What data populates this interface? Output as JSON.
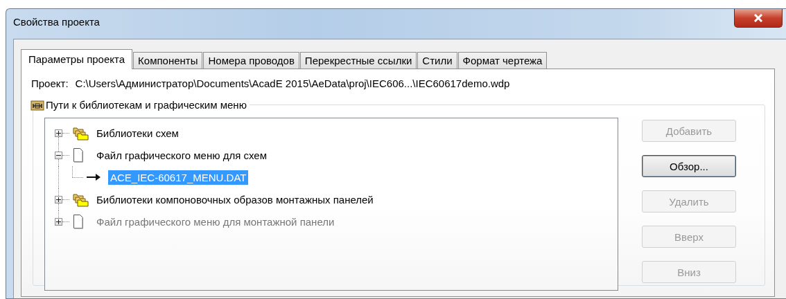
{
  "window": {
    "title": "Свойства проекта"
  },
  "tabs": [
    {
      "label": "Параметры проекта",
      "selected": true
    },
    {
      "label": "Компоненты",
      "selected": false
    },
    {
      "label": "Номера проводов",
      "selected": false
    },
    {
      "label": "Перекрестные ссылки",
      "selected": false
    },
    {
      "label": "Стили",
      "selected": false
    },
    {
      "label": "Формат чертежа",
      "selected": false
    }
  ],
  "project": {
    "label": "Проект:",
    "path": "C:\\Users\\Администратор\\Documents\\AcadE 2015\\AeData\\proj\\IEC606...\\IEC60617demo.wdp"
  },
  "group": {
    "title": "Пути к библиотекам и графическим меню"
  },
  "tree": [
    {
      "label": "Библиотеки схем",
      "kind": "folder",
      "expanded": false,
      "disabled": false,
      "selected": false
    },
    {
      "label": "Файл графического меню для схем",
      "kind": "file",
      "expanded": true,
      "disabled": false,
      "selected": false,
      "children": [
        {
          "label": "ACE_IEC-60617_MENU.DAT",
          "kind": "entry",
          "disabled": false,
          "selected": true
        }
      ]
    },
    {
      "label": "Библиотеки компоновочных образов монтажных панелей",
      "kind": "folder",
      "expanded": false,
      "disabled": false,
      "selected": false
    },
    {
      "label": "Файл графического меню для монтажной панели",
      "kind": "file",
      "expanded": false,
      "disabled": true,
      "selected": false
    }
  ],
  "buttons": [
    {
      "label": "Добавить",
      "disabled": true,
      "default": false
    },
    {
      "label": "Обзор...",
      "disabled": false,
      "default": true
    },
    {
      "label": "Удалить",
      "disabled": true,
      "default": false
    },
    {
      "label": "Вверх",
      "disabled": true,
      "default": false
    },
    {
      "label": "Вниз",
      "disabled": true,
      "default": false
    }
  ]
}
